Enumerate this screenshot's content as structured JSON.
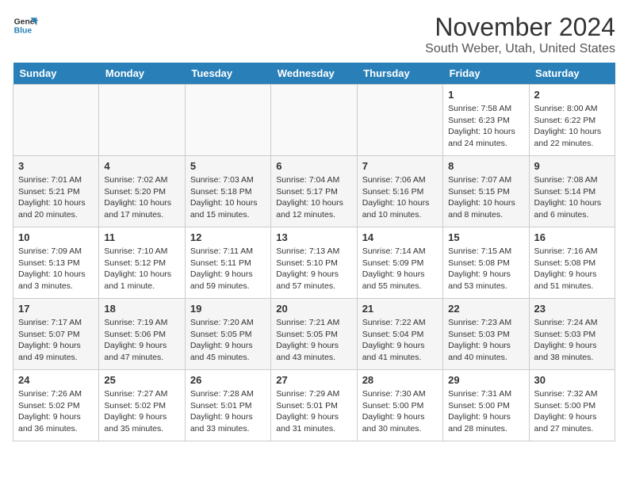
{
  "logo": {
    "line1": "General",
    "line2": "Blue"
  },
  "title": "November 2024",
  "location": "South Weber, Utah, United States",
  "days_of_week": [
    "Sunday",
    "Monday",
    "Tuesday",
    "Wednesday",
    "Thursday",
    "Friday",
    "Saturday"
  ],
  "weeks": [
    [
      {
        "day": "",
        "info": ""
      },
      {
        "day": "",
        "info": ""
      },
      {
        "day": "",
        "info": ""
      },
      {
        "day": "",
        "info": ""
      },
      {
        "day": "",
        "info": ""
      },
      {
        "day": "1",
        "info": "Sunrise: 7:58 AM\nSunset: 6:23 PM\nDaylight: 10 hours and 24 minutes."
      },
      {
        "day": "2",
        "info": "Sunrise: 8:00 AM\nSunset: 6:22 PM\nDaylight: 10 hours and 22 minutes."
      }
    ],
    [
      {
        "day": "3",
        "info": "Sunrise: 7:01 AM\nSunset: 5:21 PM\nDaylight: 10 hours and 20 minutes."
      },
      {
        "day": "4",
        "info": "Sunrise: 7:02 AM\nSunset: 5:20 PM\nDaylight: 10 hours and 17 minutes."
      },
      {
        "day": "5",
        "info": "Sunrise: 7:03 AM\nSunset: 5:18 PM\nDaylight: 10 hours and 15 minutes."
      },
      {
        "day": "6",
        "info": "Sunrise: 7:04 AM\nSunset: 5:17 PM\nDaylight: 10 hours and 12 minutes."
      },
      {
        "day": "7",
        "info": "Sunrise: 7:06 AM\nSunset: 5:16 PM\nDaylight: 10 hours and 10 minutes."
      },
      {
        "day": "8",
        "info": "Sunrise: 7:07 AM\nSunset: 5:15 PM\nDaylight: 10 hours and 8 minutes."
      },
      {
        "day": "9",
        "info": "Sunrise: 7:08 AM\nSunset: 5:14 PM\nDaylight: 10 hours and 6 minutes."
      }
    ],
    [
      {
        "day": "10",
        "info": "Sunrise: 7:09 AM\nSunset: 5:13 PM\nDaylight: 10 hours and 3 minutes."
      },
      {
        "day": "11",
        "info": "Sunrise: 7:10 AM\nSunset: 5:12 PM\nDaylight: 10 hours and 1 minute."
      },
      {
        "day": "12",
        "info": "Sunrise: 7:11 AM\nSunset: 5:11 PM\nDaylight: 9 hours and 59 minutes."
      },
      {
        "day": "13",
        "info": "Sunrise: 7:13 AM\nSunset: 5:10 PM\nDaylight: 9 hours and 57 minutes."
      },
      {
        "day": "14",
        "info": "Sunrise: 7:14 AM\nSunset: 5:09 PM\nDaylight: 9 hours and 55 minutes."
      },
      {
        "day": "15",
        "info": "Sunrise: 7:15 AM\nSunset: 5:08 PM\nDaylight: 9 hours and 53 minutes."
      },
      {
        "day": "16",
        "info": "Sunrise: 7:16 AM\nSunset: 5:08 PM\nDaylight: 9 hours and 51 minutes."
      }
    ],
    [
      {
        "day": "17",
        "info": "Sunrise: 7:17 AM\nSunset: 5:07 PM\nDaylight: 9 hours and 49 minutes."
      },
      {
        "day": "18",
        "info": "Sunrise: 7:19 AM\nSunset: 5:06 PM\nDaylight: 9 hours and 47 minutes."
      },
      {
        "day": "19",
        "info": "Sunrise: 7:20 AM\nSunset: 5:05 PM\nDaylight: 9 hours and 45 minutes."
      },
      {
        "day": "20",
        "info": "Sunrise: 7:21 AM\nSunset: 5:05 PM\nDaylight: 9 hours and 43 minutes."
      },
      {
        "day": "21",
        "info": "Sunrise: 7:22 AM\nSunset: 5:04 PM\nDaylight: 9 hours and 41 minutes."
      },
      {
        "day": "22",
        "info": "Sunrise: 7:23 AM\nSunset: 5:03 PM\nDaylight: 9 hours and 40 minutes."
      },
      {
        "day": "23",
        "info": "Sunrise: 7:24 AM\nSunset: 5:03 PM\nDaylight: 9 hours and 38 minutes."
      }
    ],
    [
      {
        "day": "24",
        "info": "Sunrise: 7:26 AM\nSunset: 5:02 PM\nDaylight: 9 hours and 36 minutes."
      },
      {
        "day": "25",
        "info": "Sunrise: 7:27 AM\nSunset: 5:02 PM\nDaylight: 9 hours and 35 minutes."
      },
      {
        "day": "26",
        "info": "Sunrise: 7:28 AM\nSunset: 5:01 PM\nDaylight: 9 hours and 33 minutes."
      },
      {
        "day": "27",
        "info": "Sunrise: 7:29 AM\nSunset: 5:01 PM\nDaylight: 9 hours and 31 minutes."
      },
      {
        "day": "28",
        "info": "Sunrise: 7:30 AM\nSunset: 5:00 PM\nDaylight: 9 hours and 30 minutes."
      },
      {
        "day": "29",
        "info": "Sunrise: 7:31 AM\nSunset: 5:00 PM\nDaylight: 9 hours and 28 minutes."
      },
      {
        "day": "30",
        "info": "Sunrise: 7:32 AM\nSunset: 5:00 PM\nDaylight: 9 hours and 27 minutes."
      }
    ]
  ]
}
